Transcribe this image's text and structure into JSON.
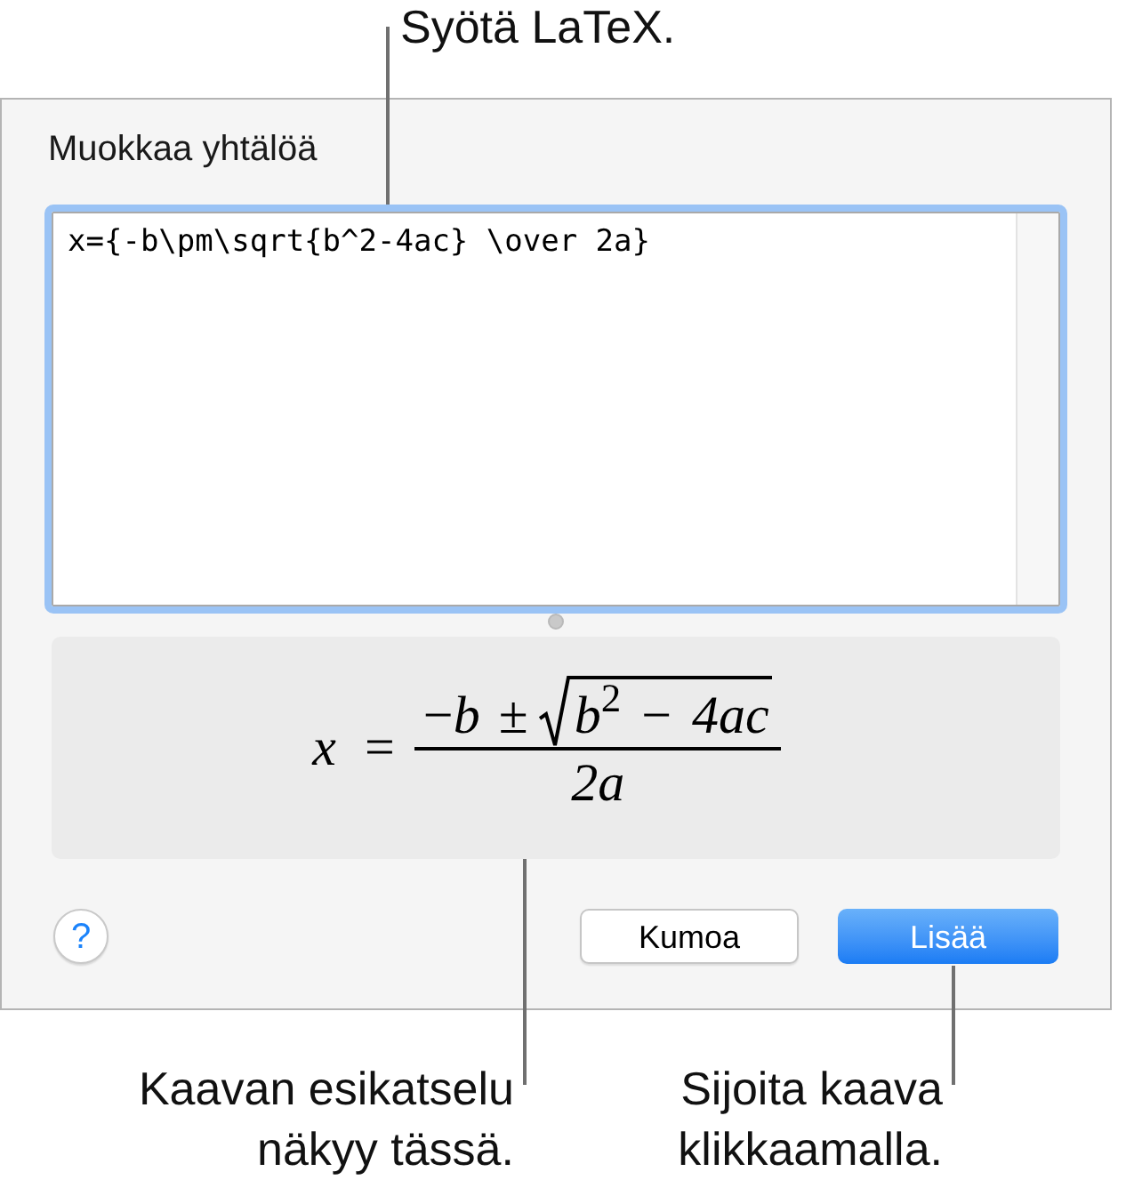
{
  "top_callout": {
    "lines": [
      "Syötä LaTeX."
    ]
  },
  "dialog": {
    "title": "Muokkaa yhtälöä",
    "latex_field": {
      "value": "x={-b\\pm\\sqrt{b^2-4ac} \\over 2a}",
      "focused": true
    },
    "preview": {
      "formula": {
        "lhs": "x",
        "relation": "=",
        "numerator": "−*b* ±",
        "radicand": "*b*$^{2}$ − *4ac*",
        "denominator": "2a"
      }
    },
    "buttons": [
      {
        "label": "?",
        "kind": "help"
      },
      {
        "label": "Kumoa",
        "kind": "secondary"
      },
      {
        "label": "Lisää",
        "kind": "primary"
      }
    ]
  },
  "bottom_callouts": [
    {
      "lines": [
        "Kaavan esikatselu",
        "näkyy tässä."
      ]
    },
    {
      "lines": [
        "Sijoita kaava",
        "klikkaamalla."
      ]
    }
  ]
}
